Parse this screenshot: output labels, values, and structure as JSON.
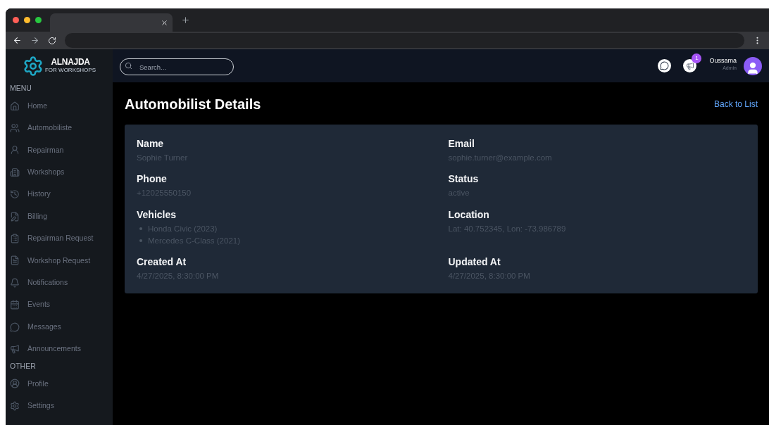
{
  "logo": {
    "title": "ALNAJDA",
    "subtitle": "FOR WORKSHOPS"
  },
  "search": {
    "placeholder": "Search..."
  },
  "header": {
    "notification_count": "1",
    "user_name": "Oussama",
    "user_role": "Admin"
  },
  "sidebar": {
    "sections": [
      {
        "title": "MENU",
        "items": [
          {
            "label": "Home"
          },
          {
            "label": "Automobiliste"
          },
          {
            "label": "Repairman"
          },
          {
            "label": "Workshops"
          },
          {
            "label": "History"
          },
          {
            "label": "Billing"
          },
          {
            "label": "Repairman Request"
          },
          {
            "label": "Workshop Request"
          },
          {
            "label": "Notifications"
          },
          {
            "label": "Events"
          },
          {
            "label": "Messages"
          },
          {
            "label": "Announcements"
          }
        ]
      },
      {
        "title": "OTHER",
        "items": [
          {
            "label": "Profile"
          },
          {
            "label": "Settings"
          }
        ]
      }
    ]
  },
  "page": {
    "title": "Automobilist Details",
    "back_link": "Back to List"
  },
  "fields": [
    {
      "kind": "text",
      "label": "Name",
      "value": "Sophie Turner"
    },
    {
      "kind": "text",
      "label": "Email",
      "value": "sophie.turner@example.com"
    },
    {
      "kind": "text",
      "label": "Phone",
      "value": "+12025550150"
    },
    {
      "kind": "text",
      "label": "Status",
      "value": "active"
    },
    {
      "kind": "list",
      "label": "Vehicles",
      "items": [
        "Honda Civic (2023)",
        "Mercedes C-Class (2021)"
      ]
    },
    {
      "kind": "text",
      "label": "Location",
      "value": "Lat: 40.752345, Lon: -73.986789"
    },
    {
      "kind": "text",
      "label": "Created At",
      "value": "4/27/2025, 8:30:00 PM"
    },
    {
      "kind": "text",
      "label": "Updated At",
      "value": "4/27/2025, 8:30:00 PM"
    }
  ]
}
